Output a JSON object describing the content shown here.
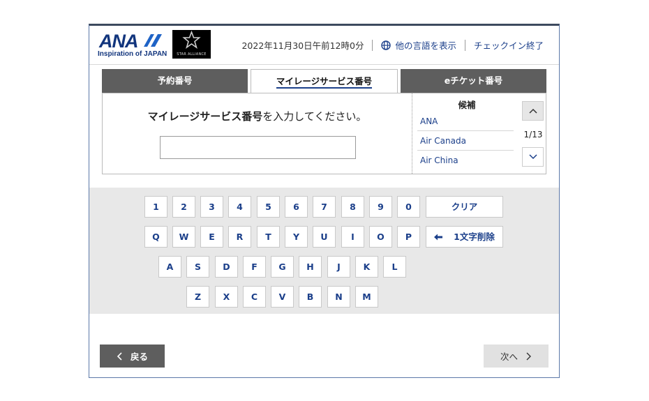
{
  "header": {
    "logo_text": "ANA",
    "logo_tagline": "Inspiration of JAPAN",
    "partner_logo_text": "STAR ALLIANCE",
    "datetime": "2022年11月30日午前12時0分",
    "language_link": "他の言語を表示",
    "finish_checkin_link": "チェックイン終了",
    "brand_color": "#12357d"
  },
  "tabs": [
    {
      "label": "予約番号",
      "selected": false
    },
    {
      "label": "マイレージサービス番号",
      "selected": true
    },
    {
      "label": "eチケット番号",
      "selected": false
    }
  ],
  "entry": {
    "prompt_bold": "マイレージサービス番号",
    "prompt_rest": "を入力してください。",
    "input_value": ""
  },
  "candidates": {
    "title": "候補",
    "items": [
      "ANA",
      "Air Canada",
      "Air China"
    ],
    "page_indicator": "1/13"
  },
  "keyboard": {
    "row1": [
      "1",
      "2",
      "3",
      "4",
      "5",
      "6",
      "7",
      "8",
      "9",
      "0"
    ],
    "clear_label": "クリア",
    "row2": [
      "Q",
      "W",
      "E",
      "R",
      "T",
      "Y",
      "U",
      "I",
      "O",
      "P"
    ],
    "backspace_label": "1文字削除",
    "row3": [
      "A",
      "S",
      "D",
      "F",
      "G",
      "H",
      "J",
      "K",
      "L"
    ],
    "row4": [
      "Z",
      "X",
      "C",
      "V",
      "B",
      "N",
      "M"
    ]
  },
  "footer": {
    "back_label": "戻る",
    "next_label": "次へ"
  }
}
